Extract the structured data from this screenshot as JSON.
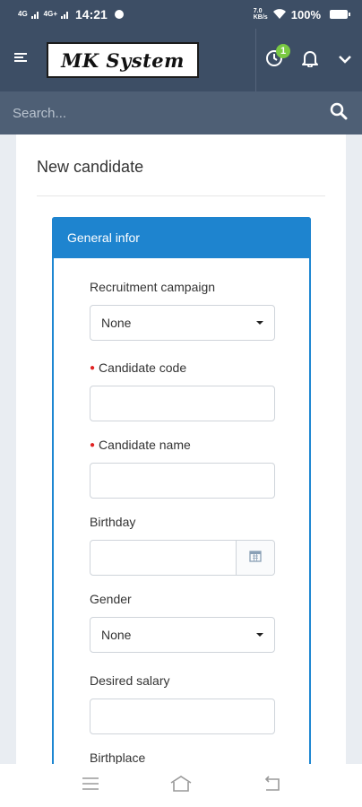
{
  "status_bar": {
    "signal_1": "4G",
    "signal_2": "4G+",
    "time": "14:21",
    "net_speed": "7.0 KB/s",
    "battery": "100%"
  },
  "header": {
    "logo_text": "MK System",
    "notification_count": "1",
    "icons": [
      "menu-icon",
      "clock-icon",
      "bell-icon",
      "chevron-down-icon"
    ]
  },
  "search": {
    "placeholder": "Search...",
    "value": ""
  },
  "page": {
    "title": "New candidate",
    "panel_title": "General infor"
  },
  "form": {
    "recruitment_campaign": {
      "label": "Recruitment campaign",
      "value": "None"
    },
    "candidate_code": {
      "label": "Candidate code",
      "required": true,
      "value": ""
    },
    "candidate_name": {
      "label": "Candidate name",
      "required": true,
      "value": ""
    },
    "birthday": {
      "label": "Birthday",
      "value": ""
    },
    "gender": {
      "label": "Gender",
      "value": "None"
    },
    "desired_salary": {
      "label": "Desired salary",
      "value": ""
    },
    "birthplace": {
      "label": "Birthplace"
    }
  },
  "nav_bar": {
    "icons": [
      "recent-apps-icon",
      "home-icon",
      "back-icon"
    ]
  },
  "colors": {
    "header_bg": "#3d4e65",
    "search_bg": "#4e5f75",
    "panel_accent": "#1e84cf",
    "badge": "#7ac943",
    "required_mark": "#e02424"
  }
}
